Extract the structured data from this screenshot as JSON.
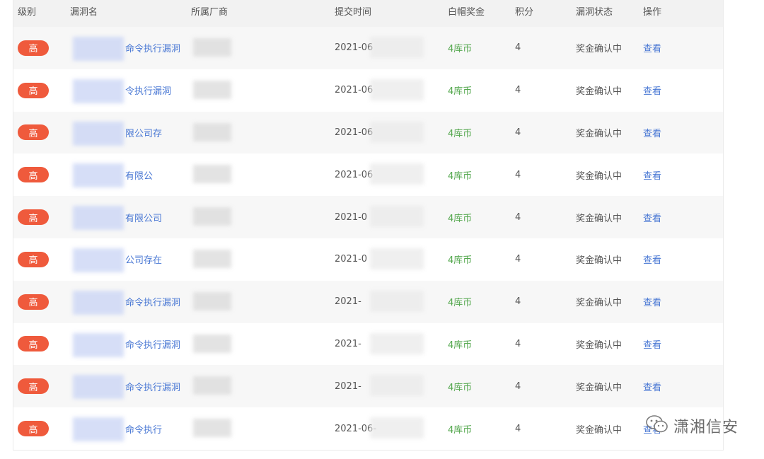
{
  "columns": [
    "级别",
    "漏洞名",
    "所属厂商",
    "提交时间",
    "白帽奖金",
    "积分",
    "漏洞状态",
    "操作"
  ],
  "rows": [
    {
      "level": "高",
      "name": "命令执行漏洞",
      "time": "2021-06",
      "reward": "4库币",
      "points": "4",
      "status": "奖金确认中",
      "action": "查看"
    },
    {
      "level": "高",
      "name": "令执行漏洞",
      "time": "2021-06",
      "reward": "4库币",
      "points": "4",
      "status": "奖金确认中",
      "action": "查看"
    },
    {
      "level": "高",
      "name": "限公司存",
      "time": "2021-06",
      "reward": "4库币",
      "points": "4",
      "status": "奖金确认中",
      "action": "查看"
    },
    {
      "level": "高",
      "name": "有限公",
      "time": "2021-06",
      "reward": "4库币",
      "points": "4",
      "status": "奖金确认中",
      "action": "查看"
    },
    {
      "level": "高",
      "name": "有限公司",
      "time": "2021-0",
      "reward": "4库币",
      "points": "4",
      "status": "奖金确认中",
      "action": "查看"
    },
    {
      "level": "高",
      "name": "公司存在",
      "time": "2021-0",
      "reward": "4库币",
      "points": "4",
      "status": "奖金确认中",
      "action": "查看"
    },
    {
      "level": "高",
      "name": "命令执行漏洞",
      "time": "2021-",
      "reward": "4库币",
      "points": "4",
      "status": "奖金确认中",
      "action": "查看"
    },
    {
      "level": "高",
      "name": "命令执行漏洞",
      "time": "2021-",
      "reward": "4库币",
      "points": "4",
      "status": "奖金确认中",
      "action": "查看"
    },
    {
      "level": "高",
      "name": "命令执行漏洞",
      "time": "2021-",
      "reward": "4库币",
      "points": "4",
      "status": "奖金确认中",
      "action": "查看"
    },
    {
      "level": "高",
      "name": "命令执行",
      "time": "2021-06-",
      "reward": "4库币",
      "points": "4",
      "status": "奖金确认中",
      "action": "查看"
    }
  ],
  "watermark": {
    "text": "潇湘信安",
    "icon": "wechat-icon"
  }
}
